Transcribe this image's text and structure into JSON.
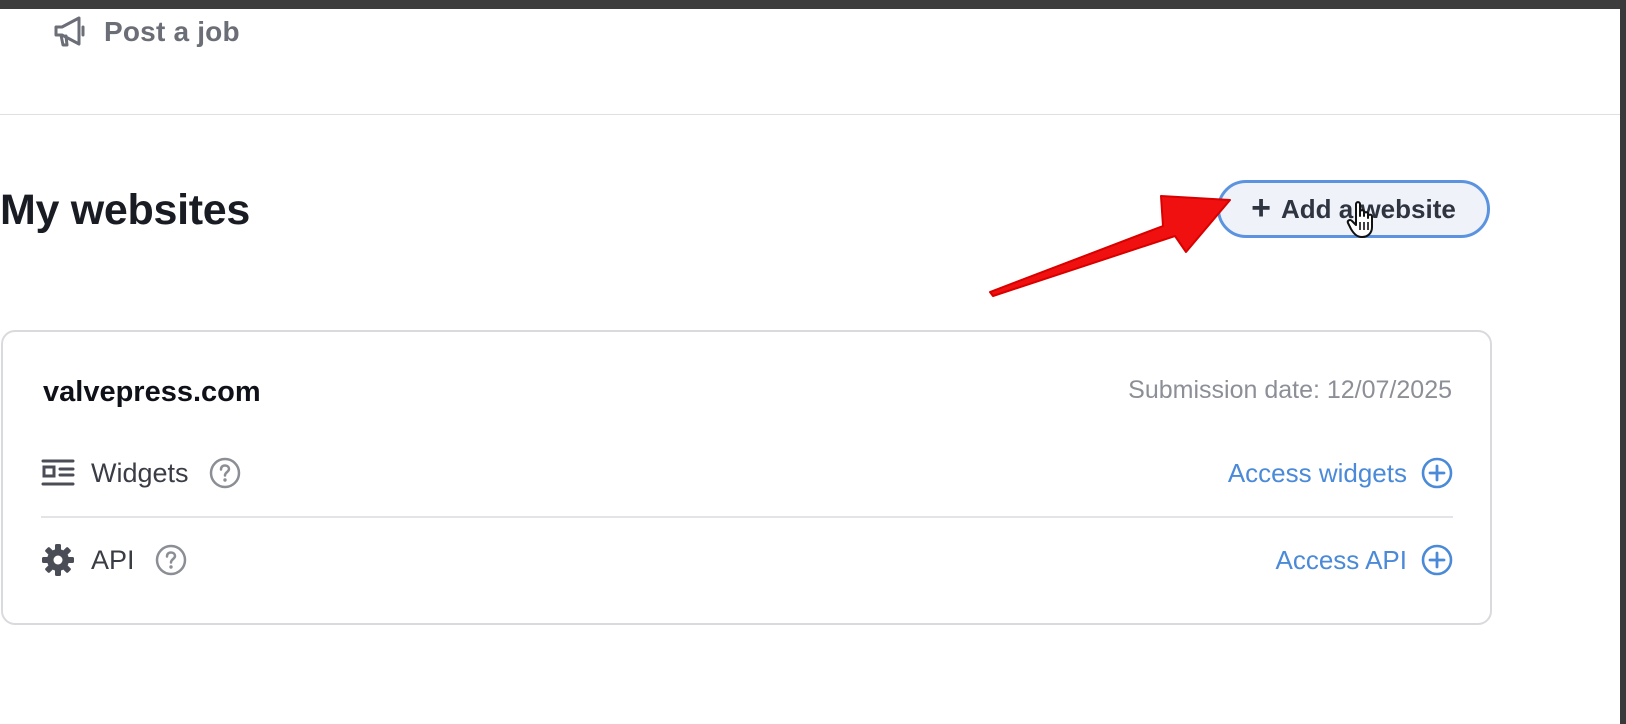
{
  "nav": {
    "post_job_label": "Post a job",
    "post_job_icon": "megaphone-icon"
  },
  "page": {
    "title": "My websites",
    "add_button_label": "Add a website",
    "add_button_icon": "plus-icon"
  },
  "websites": [
    {
      "domain": "valvepress.com",
      "submission_date": "Submission date: 12/07/2025",
      "rows": [
        {
          "label": "Widgets",
          "icon": "widgets-layout-icon",
          "help_icon": "question-circle-icon",
          "action_label": "Access widgets",
          "action_icon": "circle-plus-icon"
        },
        {
          "label": "API",
          "icon": "gear-icon",
          "help_icon": "question-circle-icon",
          "action_label": "Access API",
          "action_icon": "circle-plus-icon"
        }
      ]
    }
  ],
  "colors": {
    "accent_blue": "#4a8ad8",
    "button_border": "#5b93e0",
    "annotation_red": "#f01010",
    "muted_text": "#8c8f96"
  }
}
